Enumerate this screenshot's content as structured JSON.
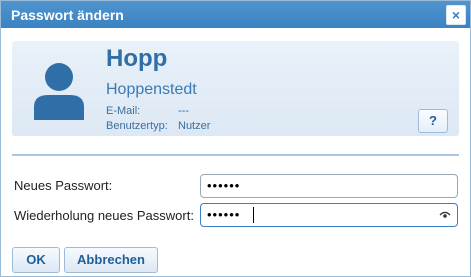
{
  "window": {
    "title": "Passwort ändern",
    "close_icon": "close-icon"
  },
  "user": {
    "short_name": "Hopp",
    "full_name": "Hoppenstedt",
    "email_label": "E-Mail:",
    "email_value": "---",
    "type_label": "Benutzertyp:",
    "type_value": "Nutzer"
  },
  "help": {
    "label": "?"
  },
  "form": {
    "new_password_label": "Neues Passwort:",
    "new_password_value": "••••••",
    "repeat_password_label": "Wiederholung neues Passwort:",
    "repeat_password_value": "••••••"
  },
  "buttons": {
    "ok": "OK",
    "cancel": "Abbrechen"
  },
  "colors": {
    "accent": "#3b82c2",
    "title_text": "#2f6ea6"
  }
}
